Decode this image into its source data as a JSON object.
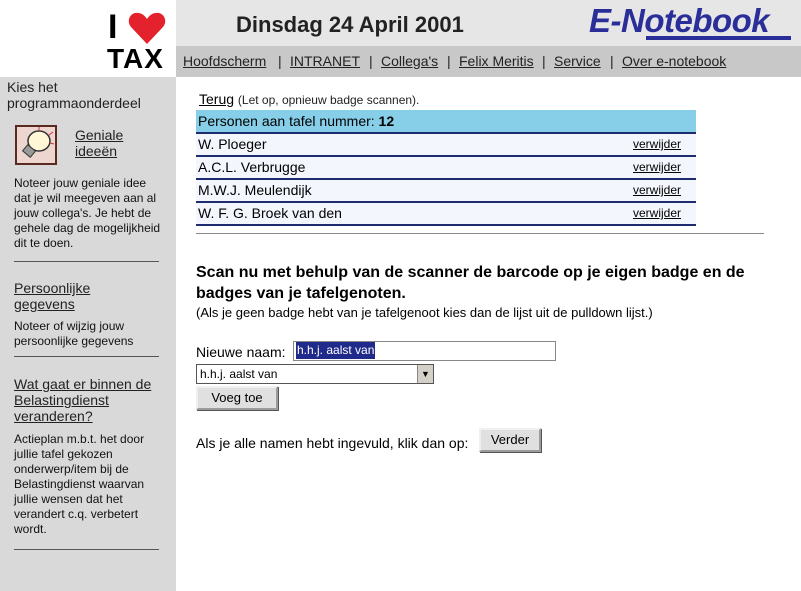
{
  "logo": {
    "i": "I",
    "tax": "TAX",
    "heart_color": "#e4222d"
  },
  "header": {
    "date": "Dinsdag 24 April 2001",
    "brand": "E-Notebook",
    "brand_color": "#2a2e98"
  },
  "nav": [
    {
      "label": "Hoofdscherm"
    },
    {
      "label": "INTRANET"
    },
    {
      "label": "Collega's"
    },
    {
      "label": "Felix Meritis"
    },
    {
      "label": "Service"
    },
    {
      "label": "Over e-notebook"
    }
  ],
  "nav_separator": "|",
  "sidebar": {
    "heading": "Kies het programmaonderdeel",
    "items": [
      {
        "label": "Geniale ideeën",
        "icon": "lightbulb-icon",
        "description": "Noteer jouw geniale idee dat je wil meegeven aan al jouw collega's. Je hebt de gehele dag de mogelijkheid dit te doen."
      },
      {
        "label": "Persoonlijke gegevens",
        "description": "Noteer of wijzig jouw persoonlijke gegevens"
      },
      {
        "label": "Wat gaat er binnen de Belastingdienst veranderen?",
        "description": "Actieplan m.b.t. het door jullie tafel gekozen onderwerp/item bij de Belastingdienst waarvan jullie wensen dat het verandert c.q. verbetert wordt."
      }
    ]
  },
  "main": {
    "back_link": "Terug",
    "back_note": "(Let op, opnieuw badge scannen).",
    "table_label": "Personen aan tafel nummer:",
    "table_number": "12",
    "persons": [
      {
        "name": "W. Ploeger",
        "action": "verwijder"
      },
      {
        "name": "A.C.L. Verbrugge",
        "action": "verwijder"
      },
      {
        "name": "M.W.J. Meulendijk",
        "action": "verwijder"
      },
      {
        "name": "W. F. G. Broek van den",
        "action": "verwijder"
      }
    ],
    "scan_instruction": "Scan nu met behulp van de scanner de barcode op je eigen badge en de badges van je tafelgenoten.",
    "hint": "(Als je geen badge hebt van je tafelgenoot kies dan de lijst uit de pulldown lijst.)",
    "new_name_label": "Nieuwe naam:",
    "new_name_value": "h.h.j. aalst van",
    "select_value": "h.h.j. aalst van",
    "add_button": "Voeg toe",
    "all_names_text": "Als je alle namen hebt ingevuld, klik dan op:",
    "next_button": "Verder"
  },
  "colors": {
    "table_header": "#87cee8",
    "row_border": "#1e2b6e",
    "sidebar_bg": "#d9d9d9"
  }
}
